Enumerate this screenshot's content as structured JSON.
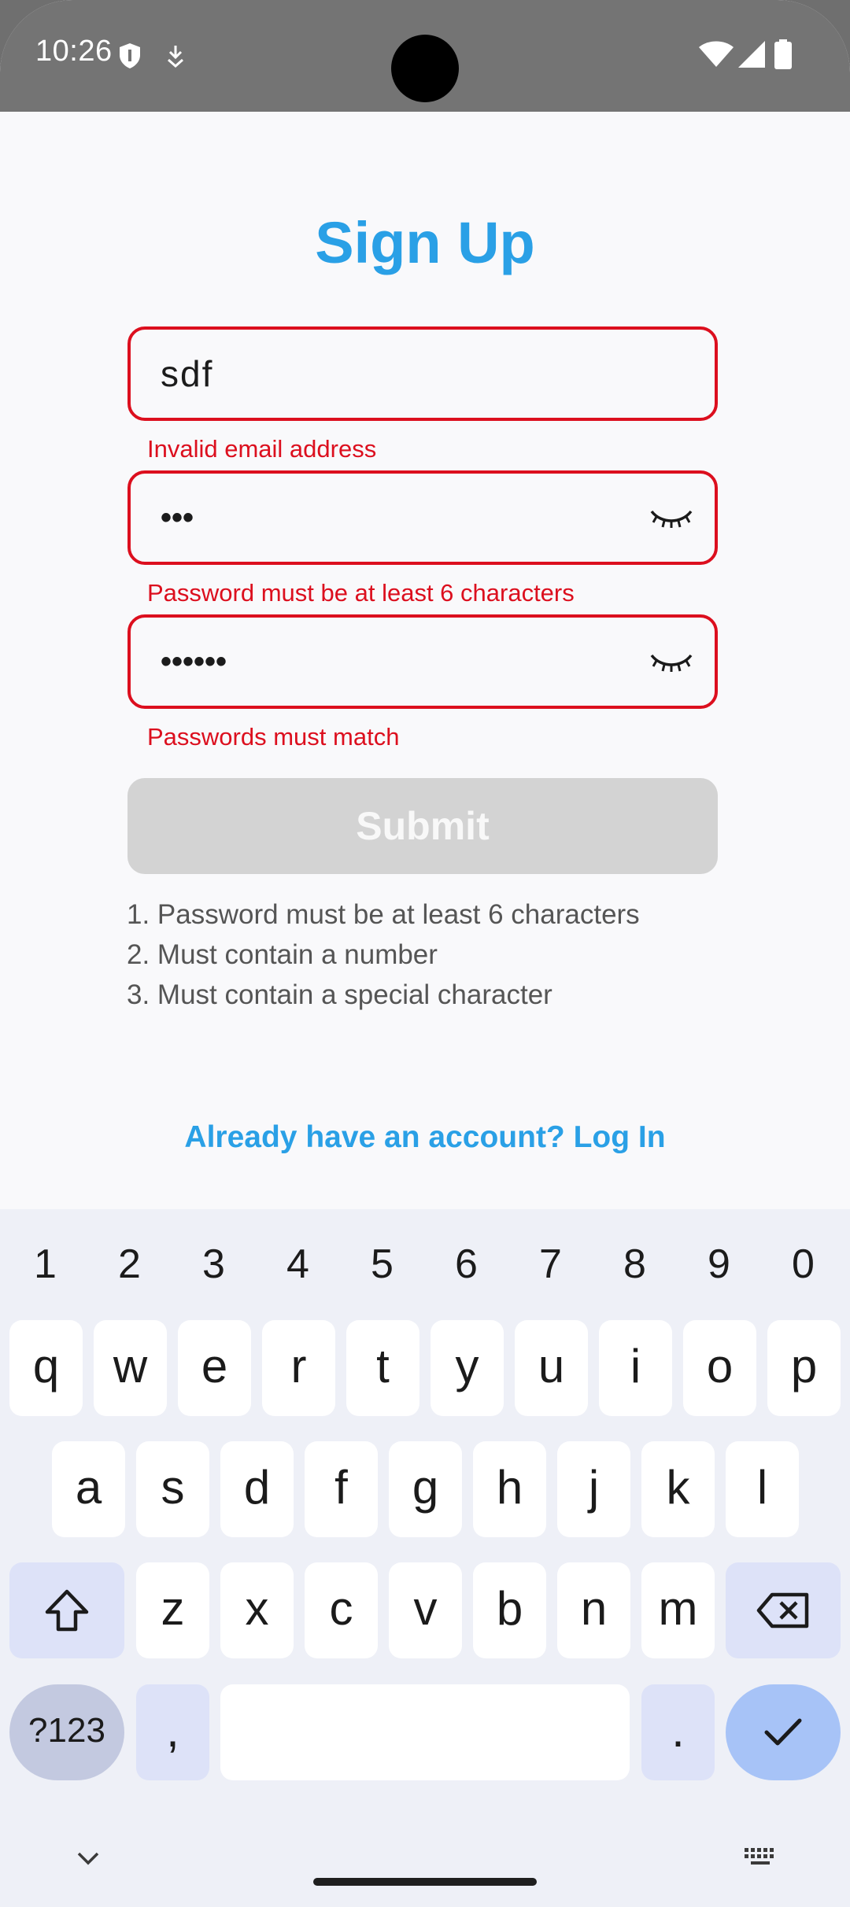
{
  "status_bar": {
    "time": "10:26",
    "icons": [
      "shield-icon",
      "download-arrow-icon",
      "wifi-icon",
      "signal-icon",
      "battery-icon"
    ]
  },
  "form": {
    "title": "Sign Up",
    "email": {
      "value": "sdf",
      "error": "Invalid email address"
    },
    "password": {
      "value": "•••",
      "error": "Password must be at least 6 characters"
    },
    "confirm_password": {
      "value": "••••••",
      "error": "Passwords must match"
    },
    "submit_label": "Submit",
    "rules": [
      "1. Password must be at least 6 characters",
      "2. Must contain a number",
      "3. Must contain a special character"
    ],
    "login_link": "Already have an account? Log In"
  },
  "keyboard": {
    "numbers": [
      "1",
      "2",
      "3",
      "4",
      "5",
      "6",
      "7",
      "8",
      "9",
      "0"
    ],
    "row1": [
      "q",
      "w",
      "e",
      "r",
      "t",
      "y",
      "u",
      "i",
      "o",
      "p"
    ],
    "row2": [
      "a",
      "s",
      "d",
      "f",
      "g",
      "h",
      "j",
      "k",
      "l"
    ],
    "row3": [
      "z",
      "x",
      "c",
      "v",
      "b",
      "n",
      "m"
    ],
    "symbols_label": "?123",
    "comma_label": ",",
    "period_label": ".",
    "icons": [
      "shift-icon",
      "backspace-icon",
      "checkmark-icon",
      "chevron-down-icon",
      "keyboard-icon"
    ]
  },
  "colors": {
    "accent": "#2aa0e6",
    "error": "#dc0f1e",
    "submit_disabled": "#d3d3d3",
    "keyboard_bg": "#eef0f7",
    "key_modifier": "#dde2f8",
    "key_enter": "#a7c3f7"
  }
}
